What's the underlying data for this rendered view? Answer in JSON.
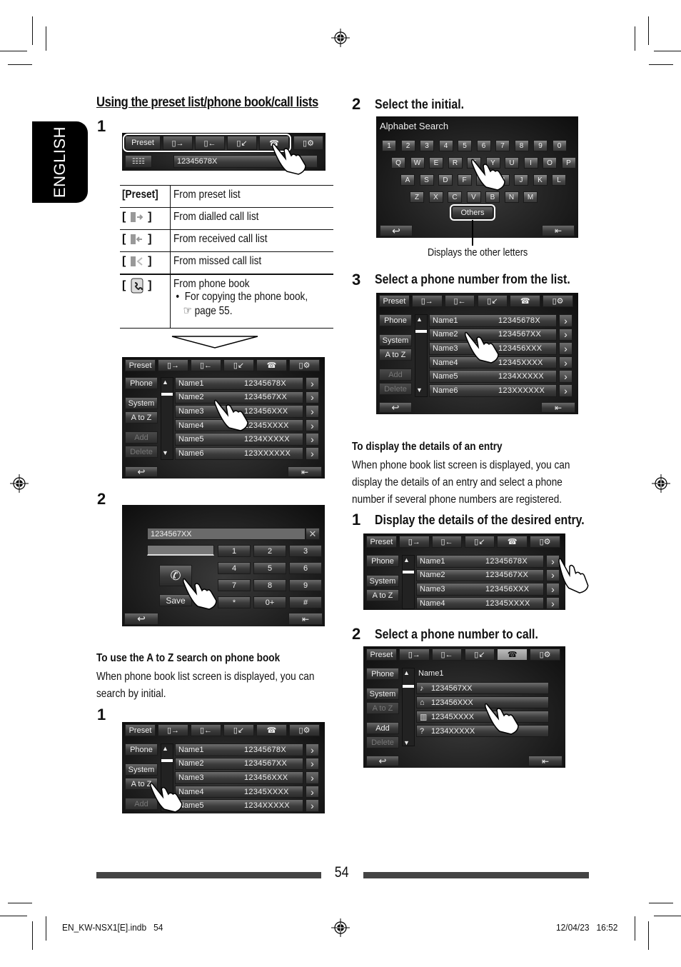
{
  "side_tab": {
    "label": "ENGLISH"
  },
  "left_column": {
    "section_title": "Using the preset list/phone book/call lists",
    "step1_number": "1",
    "top_screen": {
      "tabs": [
        "Preset",
        "dialled-calls-icon",
        "received-calls-icon",
        "missed-calls-icon",
        "phonebook-icon",
        "phone-settings-icon"
      ],
      "preset_label": "Preset",
      "display_number": "12345678X",
      "keypad_icon": "keypad-icon"
    },
    "legend": [
      {
        "key": "[Preset]",
        "icon": "",
        "text": "From preset list",
        "note": ""
      },
      {
        "key": "",
        "icon": "dialled-calls-icon",
        "text": "From dialled call list",
        "note": ""
      },
      {
        "key": "",
        "icon": "received-calls-icon",
        "text": "From received call list",
        "note": ""
      },
      {
        "key": "",
        "icon": "missed-calls-icon",
        "text": "From missed call list",
        "note": ""
      },
      {
        "key": "",
        "icon": "phonebook-icon",
        "text": "From phone book",
        "note": "For copying the phone book,",
        "ref": "page 55."
      }
    ],
    "list_screen": {
      "side_buttons": [
        "Phone",
        "System",
        "A to Z",
        "Add",
        "Delete"
      ],
      "entries": [
        {
          "name": "Name1",
          "number": "12345678X"
        },
        {
          "name": "Name2",
          "number": "1234567XX"
        },
        {
          "name": "Name3",
          "number": "123456XXX"
        },
        {
          "name": "Name4",
          "number": "12345XXXX"
        },
        {
          "name": "Name5",
          "number": "1234XXXXX"
        },
        {
          "name": "Name6",
          "number": "123XXXXXX"
        }
      ]
    },
    "step2_number": "2",
    "dial_screen": {
      "number": "1234567XX",
      "keys": [
        "1",
        "2",
        "3",
        "4",
        "5",
        "6",
        "7",
        "8",
        "9",
        "*",
        "0+",
        "#"
      ],
      "save_label": "Save"
    },
    "az_title": "To use the A to Z search on phone book",
    "az_text": [
      "When phone book list screen is displayed, you can",
      "search by initial."
    ],
    "az_step1_number": "1"
  },
  "right_column": {
    "step2": {
      "number": "2",
      "title": "Select the initial."
    },
    "alphabet_screen": {
      "title": "Alphabet Search",
      "row1": [
        "1",
        "2",
        "3",
        "4",
        "5",
        "6",
        "7",
        "8",
        "9",
        "0"
      ],
      "row2": [
        "Q",
        "W",
        "E",
        "R",
        "T",
        "Y",
        "U",
        "I",
        "O",
        "P"
      ],
      "row3": [
        "A",
        "S",
        "D",
        "F",
        "G",
        "H",
        "J",
        "K",
        "L"
      ],
      "row4": [
        "Z",
        "X",
        "C",
        "V",
        "B",
        "N",
        "M"
      ],
      "others_label": "Others",
      "callout": "Displays the other letters"
    },
    "step3": {
      "number": "3",
      "title": "Select a phone number from the list."
    },
    "details_title": "To display the details of an entry",
    "details_text": [
      "When phone book list screen is displayed, you can",
      "display the details of an entry and select a phone",
      "number if several phone numbers are registered."
    ],
    "d_step1": {
      "number": "1",
      "title": "Display the details of the desired entry."
    },
    "d_step2": {
      "number": "2",
      "title": "Select a phone number to call."
    },
    "detail_screen": {
      "entry_name": "Name1",
      "numbers": [
        {
          "icon": "mobile-icon",
          "glyph": "♪",
          "number": "1234567XX"
        },
        {
          "icon": "home-icon",
          "glyph": "⌂",
          "number": "123456XXX"
        },
        {
          "icon": "office-icon",
          "glyph": "▥",
          "number": "12345XXXX"
        },
        {
          "icon": "other-icon",
          "glyph": "?",
          "number": "1234XXXXX"
        }
      ]
    }
  },
  "footer": {
    "page_number": "54",
    "file_name": "EN_KW-NSX1[E].indb   54",
    "timestamp": "12/04/23   16:52"
  }
}
